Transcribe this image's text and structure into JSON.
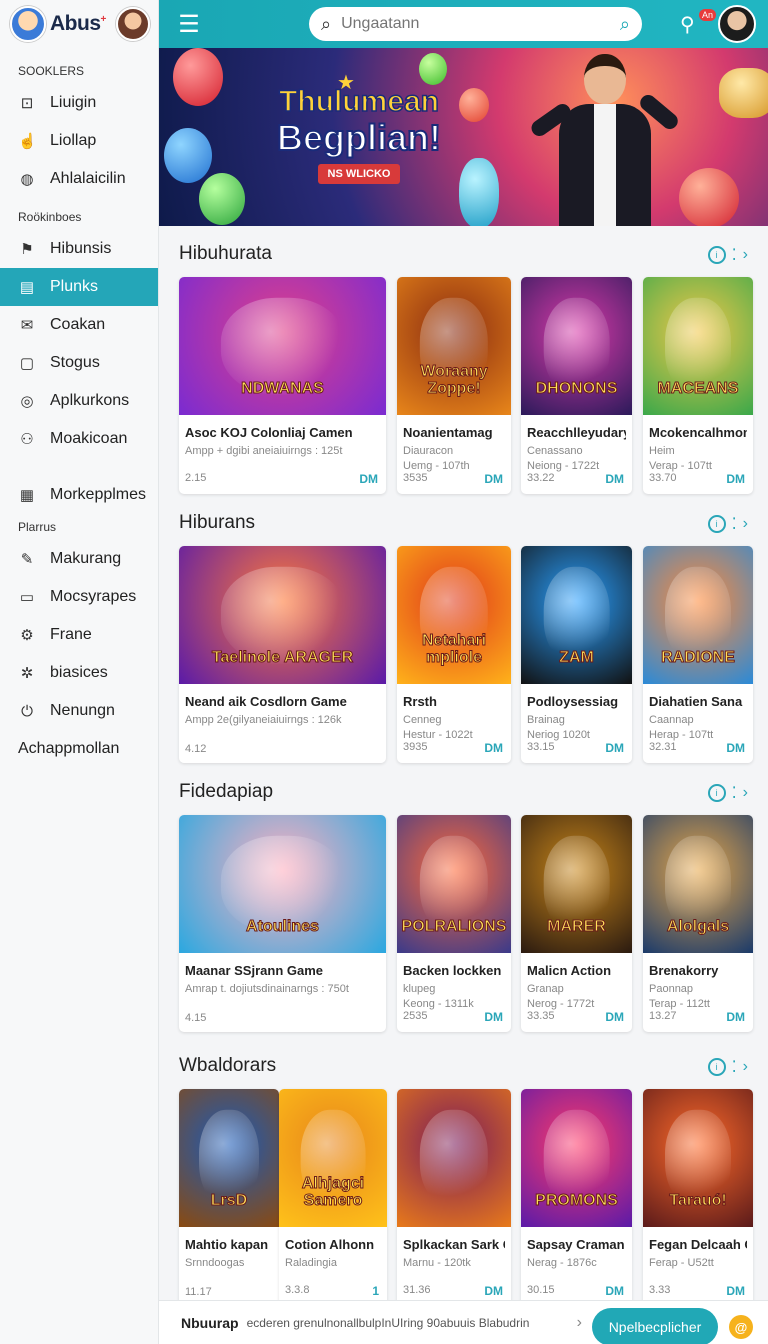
{
  "brand": {
    "name": "Abus",
    "mark": "+"
  },
  "sidebar": {
    "section1": "SOOKLERS",
    "items1": [
      {
        "label": "Liuigin",
        "icon": "box-icon"
      },
      {
        "label": "Liollap",
        "icon": "hand-icon"
      },
      {
        "label": "Ahlalaicilin",
        "icon": "shield-icon"
      }
    ],
    "section2": "Roökinboes",
    "items2": [
      {
        "label": "Hibunsis",
        "icon": "flag-icon"
      },
      {
        "label": "Plunks",
        "icon": "calendar-icon",
        "active": true
      },
      {
        "label": "Coakan",
        "icon": "mail-icon"
      },
      {
        "label": "Stogus",
        "icon": "clipboard-icon"
      },
      {
        "label": "Aplkurkons",
        "icon": "target-icon"
      },
      {
        "label": "Moakicoan",
        "icon": "users-icon"
      }
    ],
    "item_grid": {
      "label": "Morkepplmes",
      "icon": "grid-icon"
    },
    "section3": "Plarrus",
    "items3": [
      {
        "label": "Makurang",
        "icon": "edit-icon"
      },
      {
        "label": "Mocsyrapes",
        "icon": "message-icon"
      },
      {
        "label": "Frane",
        "icon": "gear-icon"
      },
      {
        "label": "biasices",
        "icon": "settings-icon"
      },
      {
        "label": "Nenungn",
        "icon": "power-icon"
      }
    ],
    "footer_item": "Achappmollan"
  },
  "topbar": {
    "search_placeholder": "Ungaatann",
    "notif_badge": "An"
  },
  "banner": {
    "line1": "Thulumean",
    "line2": "Begplian!",
    "tag": "NS WLICKO"
  },
  "sections": [
    {
      "title": "Hibuhurata",
      "cards": [
        {
          "art": "NDWANAS",
          "name": "Asoc KOJ Colonliaj Camen",
          "sub": "Ampp + dgibi aneiaiuirngs : 125t",
          "sub2": "",
          "num": "2.15",
          "tag": "DM",
          "c1": "#7a2bd1",
          "c2": "#e0408a"
        },
        {
          "art": "Woraany Zoppe!",
          "name": "Noanientamag",
          "sub": "Diauracon",
          "sub2": "Uemg - 107th",
          "num": "3535",
          "tag": "DM",
          "c1": "#e8861a",
          "c2": "#8a2b10"
        },
        {
          "art": "DHONONS",
          "name": "Reacchlleyudary",
          "sub": "Cenassano",
          "sub2": "Neiong - 1722t",
          "num": "33.22",
          "tag": "DM",
          "c1": "#2b1a5a",
          "c2": "#d83aa8"
        },
        {
          "art": "MACEANS",
          "name": "Mcokencalhmom",
          "sub": "Heim",
          "sub2": "Verap - 107tt",
          "num": "33.70",
          "tag": "DM",
          "c1": "#3aa84a",
          "c2": "#f2c84a"
        }
      ]
    },
    {
      "title": "Hiburans",
      "cards": [
        {
          "art": "Taelinole ARAGER",
          "name": "Neand aik Cosdlorn Game",
          "sub": "Ampp 2e(gilyaneiaiuirngs : 126k",
          "sub2": "",
          "num": "4.12",
          "tag": "",
          "c1": "#5a1aa8",
          "c2": "#ff7a3a"
        },
        {
          "art": "Netahari mpliole",
          "name": "Rrsth",
          "sub": "Cenneg",
          "sub2": "Hestur - 1022t",
          "num": "3935",
          "tag": "DM",
          "c1": "#ffb21a",
          "c2": "#e03a1a"
        },
        {
          "art": "ZAM",
          "name": "Podloysessiag",
          "sub": "Brainag",
          "sub2": "Neriog 1020t",
          "num": "33.15",
          "tag": "DM",
          "c1": "#111",
          "c2": "#2aa0ff"
        },
        {
          "art": "RADIONE",
          "name": "Diahatien Sana",
          "sub": "Caannap",
          "sub2": "Herap - 107tt",
          "num": "32.31",
          "tag": "DM",
          "c1": "#2a8ad8",
          "c2": "#ff8a3a"
        }
      ]
    },
    {
      "title": "Fidedapiap",
      "cards": [
        {
          "art": "Atoulines",
          "name": "Maanar SSjrann Game",
          "sub": "Amrap t. dojiutsdinainarngs : 750t",
          "sub2": "",
          "num": "4.15",
          "tag": "",
          "c1": "#2aa8e0",
          "c2": "#ffb0c0"
        },
        {
          "art": "POLRALIONS",
          "name": "Backen lockken",
          "sub": "klupeg",
          "sub2": "Keong - 1311k",
          "num": "2535",
          "tag": "DM",
          "c1": "#3a3a8a",
          "c2": "#ff6a3a"
        },
        {
          "art": "MARER",
          "name": "Malicn Action",
          "sub": "Granap",
          "sub2": "Nerog - 1772t",
          "num": "33.35",
          "tag": "DM",
          "c1": "#2a1a10",
          "c2": "#c8861a"
        },
        {
          "art": "Alolgals",
          "name": "Brenakorry",
          "sub": "Paonnap",
          "sub2": "Terap - 112tt",
          "num": "13.27",
          "tag": "DM",
          "c1": "#1a3a6a",
          "c2": "#e8a84a"
        }
      ]
    },
    {
      "title": "Wbaldorars",
      "cards": [
        {
          "art": "LrsD",
          "name": "Mahtio kapan",
          "sub": "Srnndoogas",
          "sub2": "",
          "num": "11.17",
          "tag": "",
          "c1": "#8a4a10",
          "c2": "#1a5ab8"
        },
        {
          "art": "Alhjagci Samero",
          "name": "Cotion Alhonn",
          "sub": "Raladingia",
          "sub2": "",
          "num": "3.3.8",
          "tag": "1",
          "c1": "#ffc21a",
          "c2": "#e8861a"
        },
        {
          "art": "",
          "name": "Splkackan Sark Granap",
          "sub": "Marnu - 120tk",
          "sub2": "",
          "num": "31.36",
          "tag": "DM",
          "c1": "#e87a1a",
          "c2": "#7a1a5a"
        },
        {
          "art": "PROMONS",
          "name": "Sapsay Craman",
          "sub": "Nerag - 1876c",
          "sub2": "",
          "num": "30.15",
          "tag": "DM",
          "c1": "#5a1aa8",
          "c2": "#ff3a6a"
        },
        {
          "art": "Tarauó!",
          "name": "Fegan Delcaah Gramap",
          "sub": "Ferap - U52tt",
          "sub2": "",
          "num": "3.33",
          "tag": "DM",
          "c1": "#5a1a1a",
          "c2": "#ff6a2a"
        }
      ]
    }
  ],
  "bottombar": {
    "title": "Nbuurap",
    "text": "ecderen grenulnonallbulpInUIring 90abuuis Blabudrin",
    "button": "Npelbecplicher",
    "coin": "@"
  },
  "colors": {
    "accent": "#21a8b6",
    "active_bg": "#24a6b8"
  }
}
